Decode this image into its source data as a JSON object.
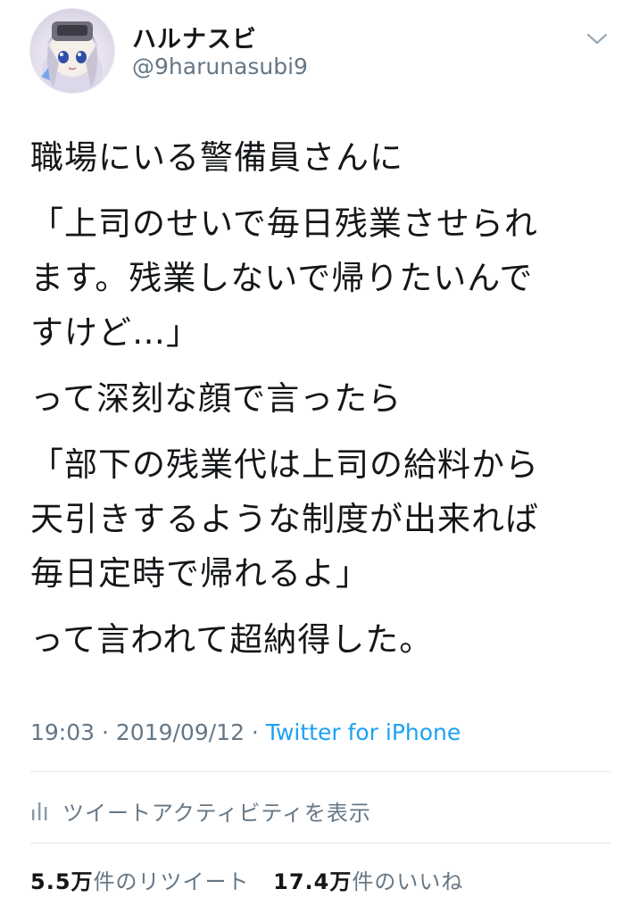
{
  "user": {
    "display_name": "ハルナスビ",
    "handle": "@9harunasubi9",
    "avatar_icon": "avatar-image",
    "menu_icon": "chevron-down-icon"
  },
  "tweet": {
    "lines": [
      "職場にいる警備員さんに",
      "「上司のせいで毎日残業させられ",
      "ます。残業しないで帰りたいんで",
      "すけど…」",
      "って深刻な顔で言ったら",
      "「部下の残業代は上司の給料から",
      "天引きするような制度が出来れば",
      "毎日定時で帰れるよ」",
      "って言われて超納得した。"
    ]
  },
  "meta": {
    "time": "19:03",
    "separator1": " · ",
    "date": "2019/09/12",
    "separator2": " · ",
    "source": "Twitter for iPhone"
  },
  "activity": {
    "icon": "bar-chart-icon",
    "label": "ツイートアクティビティを表示"
  },
  "stats": {
    "retweets_count": "5.5万",
    "retweets_label": "件のリツイート",
    "likes_count": "17.4万",
    "likes_label": "件のいいね"
  },
  "colors": {
    "text": "#14171a",
    "secondary": "#657786",
    "link": "#1da1f2",
    "divider": "#e1e8ed"
  }
}
